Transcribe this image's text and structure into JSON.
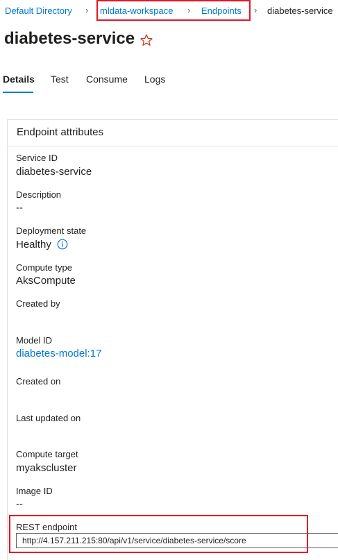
{
  "breadcrumb": {
    "root": "Default Directory",
    "workspace": "mldata-workspace",
    "endpoints": "Endpoints",
    "current": "diabetes-service"
  },
  "page": {
    "title": "diabetes-service"
  },
  "tabs": [
    {
      "label": "Details",
      "active": true
    },
    {
      "label": "Test",
      "active": false
    },
    {
      "label": "Consume",
      "active": false
    },
    {
      "label": "Logs",
      "active": false
    }
  ],
  "card": {
    "title": "Endpoint attributes"
  },
  "attributes": {
    "service_id": {
      "label": "Service ID",
      "value": "diabetes-service"
    },
    "description": {
      "label": "Description",
      "value": "--"
    },
    "deployment_state": {
      "label": "Deployment state",
      "value": "Healthy"
    },
    "compute_type": {
      "label": "Compute type",
      "value": "AksCompute"
    },
    "created_by": {
      "label": "Created by",
      "value": ""
    },
    "model_id": {
      "label": "Model ID",
      "value": "diabetes-model:17"
    },
    "created_on": {
      "label": "Created on",
      "value": ""
    },
    "last_updated_on": {
      "label": "Last updated on",
      "value": ""
    },
    "compute_target": {
      "label": "Compute target",
      "value": "myakscluster"
    },
    "image_id": {
      "label": "Image ID",
      "value": "--"
    },
    "rest_endpoint": {
      "label": "REST endpoint",
      "value": "http://4.157.211.215:80/api/v1/service/diabetes-service/score"
    }
  },
  "colors": {
    "link": "#0078d4",
    "highlight": "#e81123",
    "star": "#c43e1c",
    "text": "#201f1e"
  },
  "icons": {
    "favorite": "star-outline-icon",
    "info": "info-circle-icon",
    "separator": "chevron-right-icon"
  }
}
